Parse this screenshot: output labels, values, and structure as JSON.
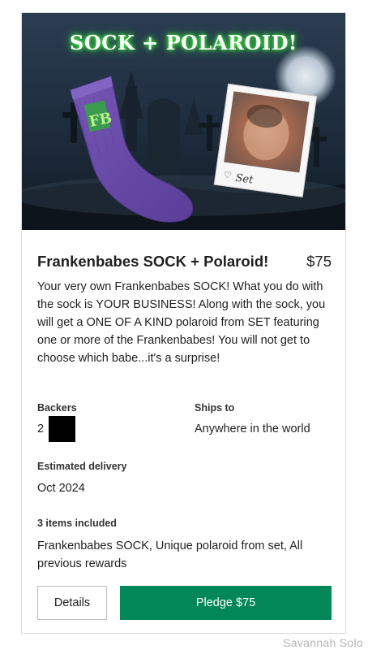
{
  "hero": {
    "title": "SOCK + POLAROID!",
    "sock_logo": "FB",
    "signature": "Set"
  },
  "reward": {
    "title": "Frankenbabes SOCK + Polaroid!",
    "price": "$75",
    "description": "Your very own Frankenbabes SOCK! What you do with the sock is YOUR BUSINESS! Along with the sock, you will get a ONE OF A KIND polaroid from SET featuring one or more of the Frankenbabes! You will not get to choose which babe...it's a surprise!"
  },
  "details": {
    "backers_label": "Backers",
    "backers_value": "2",
    "ships_to_label": "Ships to",
    "ships_to_value": "Anywhere in the world",
    "delivery_label": "Estimated delivery",
    "delivery_value": "Oct 2024",
    "items_label": "3 items included",
    "items_value": "Frankenbabes SOCK, Unique polaroid from set, All previous rewards"
  },
  "actions": {
    "details_label": "Details",
    "pledge_label": "Pledge $75"
  },
  "colors": {
    "pledge_button": "#028858",
    "sock": "#6a4ba8",
    "title_glow": "#4dff4d"
  },
  "watermark": "Savannah Solo"
}
